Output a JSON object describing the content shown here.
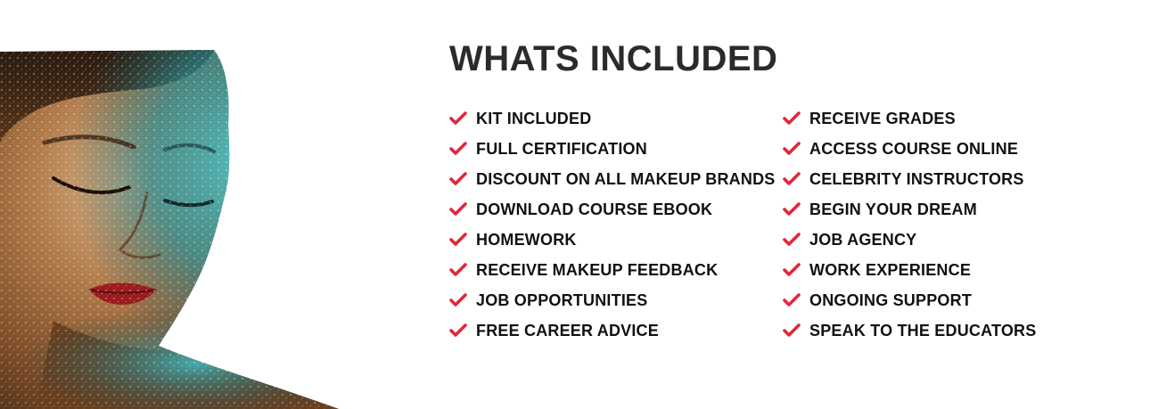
{
  "section": {
    "title": "WHATS INCLUDED"
  },
  "colors": {
    "accent": "#e3263a",
    "title": "#2b2b2b",
    "text": "#111111"
  },
  "image": {
    "semantic": "glitter-makeup-face-photo"
  },
  "features": {
    "left": [
      {
        "label": "KIT INCLUDED",
        "icon": "checkmark-icon"
      },
      {
        "label": "FULL CERTIFICATION",
        "icon": "checkmark-icon"
      },
      {
        "label": "DISCOUNT ON ALL MAKEUP BRANDS",
        "icon": "checkmark-icon"
      },
      {
        "label": "DOWNLOAD COURSE EBOOK",
        "icon": "checkmark-icon"
      },
      {
        "label": "HOMEWORK",
        "icon": "checkmark-icon"
      },
      {
        "label": "RECEIVE MAKEUP FEEDBACK",
        "icon": "checkmark-icon"
      },
      {
        "label": "JOB OPPORTUNITIES",
        "icon": "checkmark-icon"
      },
      {
        "label": "FREE CAREER ADVICE",
        "icon": "checkmark-icon"
      }
    ],
    "right": [
      {
        "label": "RECEIVE GRADES",
        "icon": "checkmark-icon"
      },
      {
        "label": "ACCESS COURSE ONLINE",
        "icon": "checkmark-icon"
      },
      {
        "label": "CELEBRITY INSTRUCTORS",
        "icon": "checkmark-icon"
      },
      {
        "label": "BEGIN YOUR DREAM",
        "icon": "checkmark-icon"
      },
      {
        "label": "JOB AGENCY",
        "icon": "checkmark-icon"
      },
      {
        "label": "WORK EXPERIENCE",
        "icon": "checkmark-icon"
      },
      {
        "label": "ONGOING SUPPORT",
        "icon": "checkmark-icon"
      },
      {
        "label": "SPEAK TO THE EDUCATORS",
        "icon": "checkmark-icon"
      }
    ]
  }
}
